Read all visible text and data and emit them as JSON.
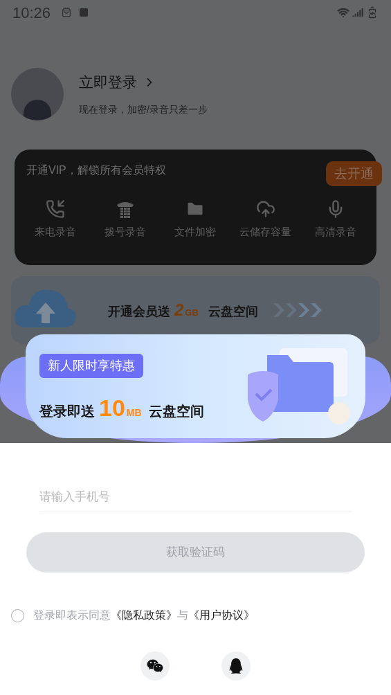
{
  "status_bar": {
    "time": "10:26"
  },
  "profile": {
    "title": "立即登录",
    "subtitle": "现在登录，加密/录音只差一步"
  },
  "vip_card": {
    "title": "开通VIP，解锁所有会员特权",
    "button": "去开通",
    "features": [
      {
        "kind": "incoming-call",
        "label": "来电录音"
      },
      {
        "kind": "dialpad",
        "label": "拨号录音"
      },
      {
        "kind": "folder",
        "label": "文件加密"
      },
      {
        "kind": "cloud",
        "label": "云储存容量"
      },
      {
        "kind": "mic",
        "label": "高清录音"
      }
    ]
  },
  "cloud_banner": {
    "prefix": "开通会员送",
    "amount": "2",
    "unit": "GB",
    "suffix": "云盘空间"
  },
  "promo": {
    "badge": "新人限时享特惠",
    "prefix": "登录即送",
    "amount": "10",
    "unit": "MB",
    "suffix": "云盘空间"
  },
  "phone_field": {
    "placeholder": "请输入手机号"
  },
  "submit_button": {
    "label": "获取验证码",
    "disabled": true
  },
  "agreement": {
    "checked": false,
    "text": "登录即表示同意",
    "privacy_link": "《隐私政策》",
    "joiner": "与",
    "terms_link": "《用户协议》"
  },
  "social_logins": [
    {
      "kind": "wechat"
    },
    {
      "kind": "qq"
    }
  ]
}
